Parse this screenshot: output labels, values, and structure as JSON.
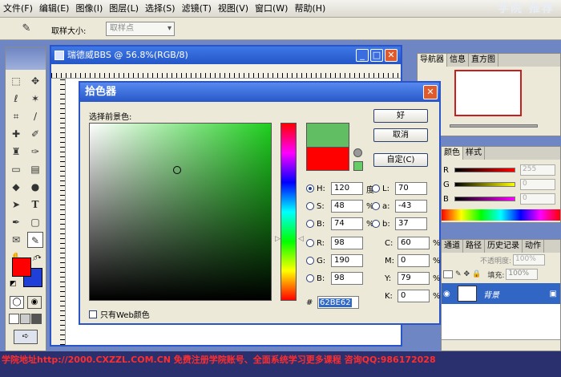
{
  "brand": "学院 推荐",
  "menu": [
    "文件(F)",
    "编辑(E)",
    "图像(I)",
    "图层(L)",
    "选择(S)",
    "滤镜(T)",
    "视图(V)",
    "窗口(W)",
    "帮助(H)"
  ],
  "options": {
    "sample_size_label": "取样大小:",
    "sample_size_value": "取样点"
  },
  "document": {
    "title": "瑞德威BBS @ 56.8%(RGB/8)",
    "minimize": "_",
    "maximize": "□",
    "close": "✕"
  },
  "navigator": {
    "tabs": [
      "导航器",
      "信息",
      "直方图"
    ]
  },
  "color_panel": {
    "tabs": [
      "颜色",
      "样式"
    ],
    "channels": [
      {
        "label": "R",
        "value": "255",
        "color": "#ff0000"
      },
      {
        "label": "G",
        "value": "0",
        "color": "#ffff00"
      },
      {
        "label": "B",
        "value": "0",
        "color": "#ff00ff"
      }
    ]
  },
  "layers_panel": {
    "tabs": [
      "通道",
      "路径",
      "历史记录",
      "动作"
    ],
    "opacity_label": "不透明度:",
    "opacity_value": "100%",
    "fill_label": "填充:",
    "fill_value": "100%",
    "layer_name": "背景"
  },
  "picker": {
    "title": "拾色器",
    "close": "✕",
    "select_label": "选择前景色:",
    "ok": "好",
    "cancel": "取消",
    "custom": "自定(C)",
    "web_only": "只有Web颜色",
    "new_color": "#62be62",
    "old_color": "#ff0000",
    "base_hue_color": "#1fcf1f",
    "hsb": [
      {
        "label": "H:",
        "value": "120",
        "unit": "度",
        "selected": true
      },
      {
        "label": "S:",
        "value": "48",
        "unit": "%",
        "selected": false
      },
      {
        "label": "B:",
        "value": "74",
        "unit": "%",
        "selected": false
      }
    ],
    "rgb": [
      {
        "label": "R:",
        "value": "98"
      },
      {
        "label": "G:",
        "value": "190"
      },
      {
        "label": "B:",
        "value": "98"
      }
    ],
    "lab": [
      {
        "label": "L:",
        "value": "70"
      },
      {
        "label": "a:",
        "value": "-43"
      },
      {
        "label": "b:",
        "value": "37"
      }
    ],
    "cmyk": [
      {
        "label": "C:",
        "value": "60",
        "unit": "%"
      },
      {
        "label": "M:",
        "value": "0",
        "unit": "%"
      },
      {
        "label": "Y:",
        "value": "79",
        "unit": "%"
      },
      {
        "label": "K:",
        "value": "0",
        "unit": "%"
      }
    ],
    "hex_label": "#",
    "hex_value": "62BE62"
  },
  "foreground_color": "#ff0000",
  "background_color": "#1f3fd8",
  "footer": "学院地址http://2000.CXZZL.COM.CN 免费注册学院账号、全面系统学习更多课程 咨询QQ:986172028"
}
